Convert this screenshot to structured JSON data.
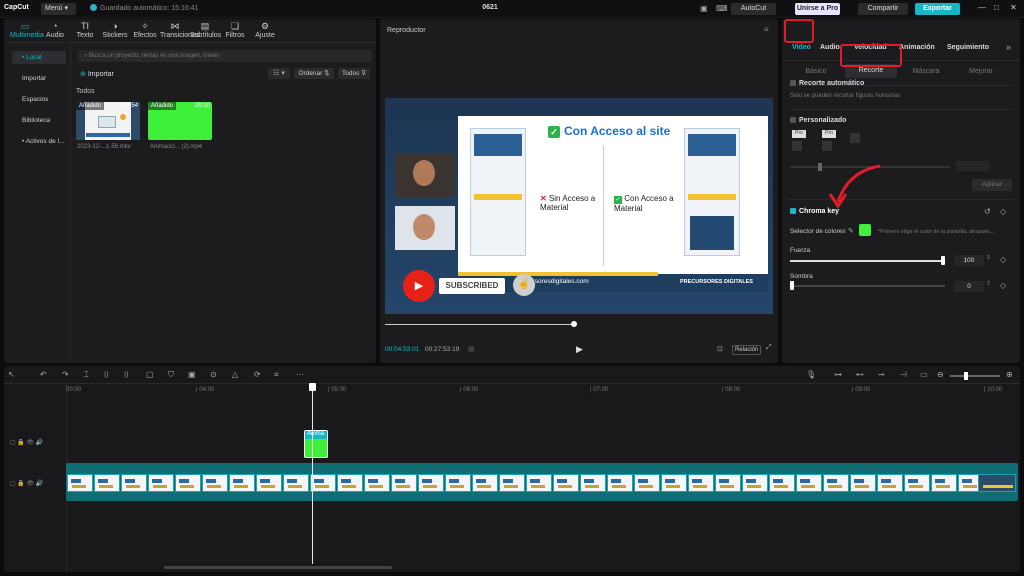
{
  "titlebar": {
    "logo": "CapCut",
    "menu": "Menú",
    "saved": "Guardado automático: 15:16:41",
    "project": "0621",
    "autocut": "AutoCut",
    "join_pro": "Unirse a Pro",
    "share": "Compartir",
    "export": "Exportar"
  },
  "toolbar": {
    "tabs": [
      {
        "label": "Multimedia",
        "icon": "media-icon"
      },
      {
        "label": "Audio",
        "icon": "audio-icon"
      },
      {
        "label": "Texto",
        "icon": "text-icon"
      },
      {
        "label": "Stickers",
        "icon": "sticker-icon"
      },
      {
        "label": "Efectos",
        "icon": "effects-icon"
      },
      {
        "label": "Transiciones",
        "icon": "transitions-icon"
      },
      {
        "label": "Subtítulos",
        "icon": "subtitles-icon"
      },
      {
        "label": "Filtros",
        "icon": "filters-icon"
      },
      {
        "label": "Ajuste",
        "icon": "adjust-icon"
      }
    ]
  },
  "sidebar": {
    "items": [
      "• Local",
      "Importar",
      "Espacios",
      "Biblioteca",
      "• Activos de I..."
    ]
  },
  "media": {
    "search_placeholder": "Busca un proyecto, temas en una imagen, líneas",
    "import": "Importar",
    "sort": "Ordenar",
    "all": "Todos",
    "section": "Todos",
    "items": [
      {
        "tag": "Añadido",
        "duration": "27:54",
        "name": "2023-12-...1-56.mkv"
      },
      {
        "tag": "Añadido",
        "duration": "00:10",
        "name": "Animació... (2).mp4"
      }
    ]
  },
  "player": {
    "title": "Reproductor",
    "time_current": "00:04:53:01",
    "time_total": "00:27:53:19",
    "ratio": "Relación",
    "slide": {
      "headline": "Con Acceso al site",
      "no_access": "Sin Acceso a Material",
      "with_access": "Con Acceso a Material",
      "footer_url": "recursoresdigitales.com",
      "footer_brand": "PRECURSORES DIGITALES",
      "subscribed": "SUBSCRIBED"
    }
  },
  "inspector": {
    "tabs": [
      "Video",
      "Audio",
      "Velocidad",
      "Animación",
      "Seguimiento"
    ],
    "subtabs": [
      "Básico",
      "Recorte",
      "Máscara",
      "Mejorar"
    ],
    "auto_cut": {
      "label": "Recorte automático",
      "hint": "Solo se pueden recortar figuras humanas"
    },
    "custom": {
      "label": "Personalizado",
      "apply": "Aplicar"
    },
    "chroma": {
      "label": "Chroma key",
      "picker": "Selector de colores",
      "picker_hint": "*Primero elige el color de la pantalla, después...",
      "strength": "Fuerza",
      "strength_value": "100",
      "shadow": "Sombra",
      "shadow_value": "0",
      "key_color": "#3ef03a"
    }
  },
  "timeline": {
    "ticks": [
      "00:00",
      "| 04:00",
      "| 05:00",
      "| 06:00",
      "| 07:00",
      "| 08:00",
      "| 09:00",
      "| 10:00"
    ],
    "overlay_clip": "Anima"
  },
  "colors": {
    "accent": "#17b7c4",
    "annotation": "#e11d2b",
    "green": "#3ef03a"
  }
}
